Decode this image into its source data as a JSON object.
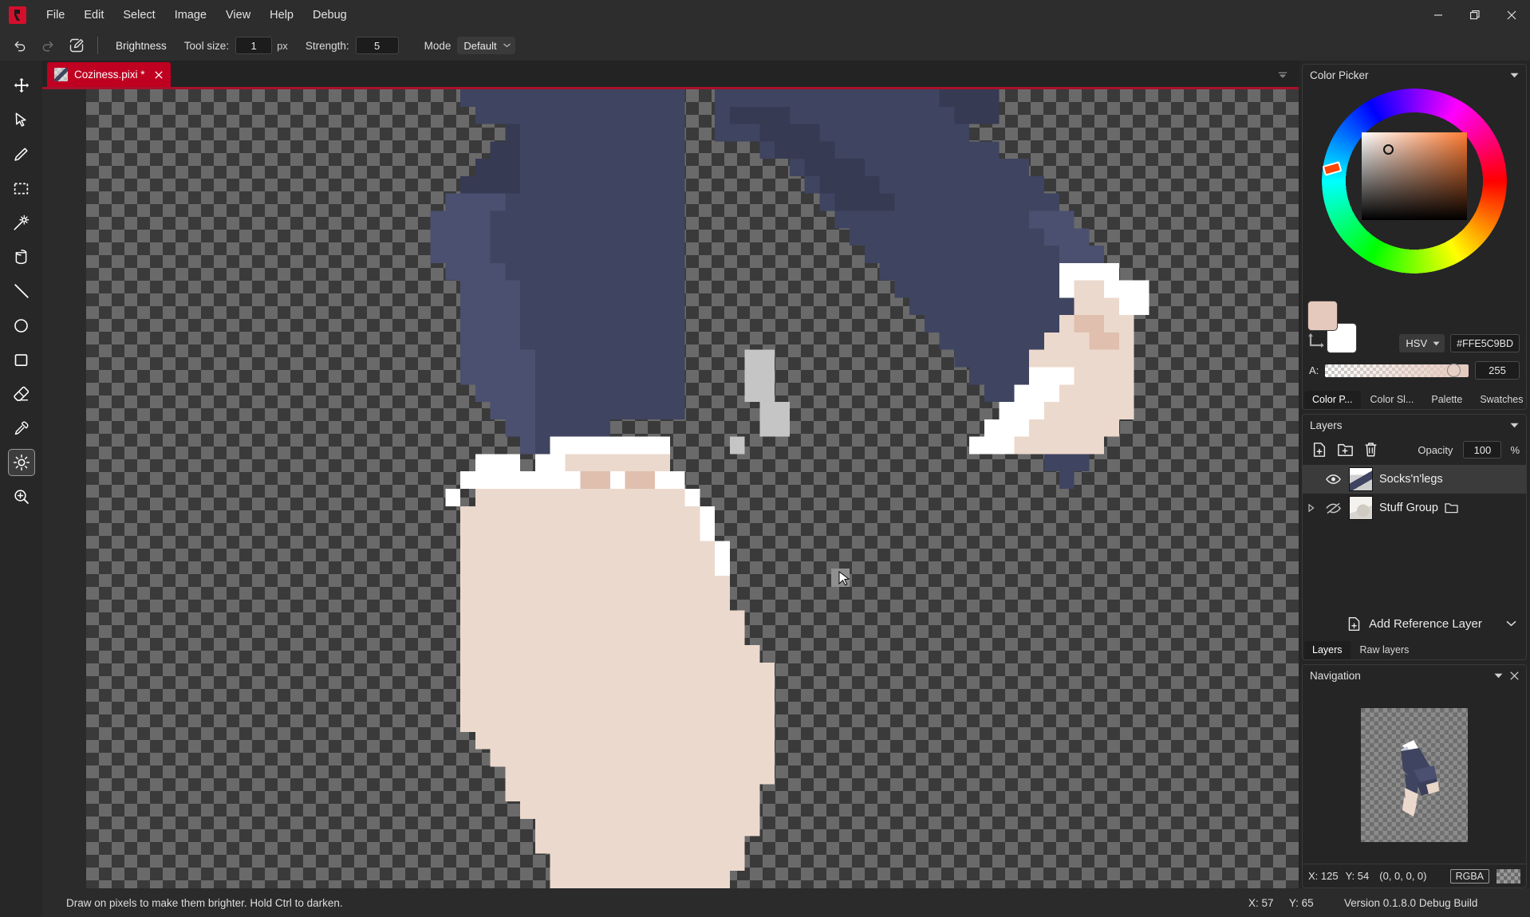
{
  "app": {
    "logo_icon": "pixi-logo-icon",
    "menu": [
      "File",
      "Edit",
      "Select",
      "Image",
      "View",
      "Help",
      "Debug"
    ],
    "window_controls": [
      {
        "name": "minimize-button",
        "icon": "minimize-icon"
      },
      {
        "name": "maximize-button",
        "icon": "maximize-icon"
      },
      {
        "name": "close-button",
        "icon": "close-icon"
      }
    ]
  },
  "optionbar": {
    "undo_icon": "undo-icon",
    "redo_icon": "redo-icon",
    "edit_icon": "edit-pencil-square-icon",
    "tool_name": "Brightness",
    "tool_size_label": "Tool size:",
    "tool_size_value": "1",
    "tool_size_unit": "px",
    "strength_label": "Strength:",
    "strength_value": "5",
    "mode_label": "Mode",
    "mode_value": "Default"
  },
  "toolbar": {
    "tools": [
      {
        "name": "tool-move",
        "icon": "move-arrows-icon",
        "label": "Move",
        "active": false
      },
      {
        "name": "tool-select-cursor",
        "icon": "cursor-arrow-icon",
        "label": "Select",
        "active": false
      },
      {
        "name": "tool-pencil",
        "icon": "pencil-icon",
        "label": "Pencil",
        "active": false
      },
      {
        "name": "tool-rect-select",
        "icon": "marquee-dashed-rect-icon",
        "label": "Rectangle Select",
        "active": false
      },
      {
        "name": "tool-magic-wand",
        "icon": "magic-wand-icon",
        "label": "Magic Wand",
        "active": false
      },
      {
        "name": "tool-bucket",
        "icon": "paint-bucket-icon",
        "label": "Bucket Fill",
        "active": false
      },
      {
        "name": "tool-line",
        "icon": "line-icon",
        "label": "Line",
        "active": false
      },
      {
        "name": "tool-ellipse",
        "icon": "ellipse-icon",
        "label": "Ellipse",
        "active": false
      },
      {
        "name": "tool-rectangle",
        "icon": "rectangle-icon",
        "label": "Rectangle",
        "active": false
      },
      {
        "name": "tool-eraser",
        "icon": "eraser-icon",
        "label": "Eraser",
        "active": false
      },
      {
        "name": "tool-eyedropper",
        "icon": "eyedropper-icon",
        "label": "Color Picker",
        "active": false
      },
      {
        "name": "tool-brightness",
        "icon": "sun-brightness-icon",
        "label": "Brightness",
        "active": true
      },
      {
        "name": "tool-zoom",
        "icon": "magnifier-plus-icon",
        "label": "Zoom",
        "active": false
      }
    ]
  },
  "tab": {
    "title": "Coziness.pixi *",
    "close_icon": "close-icon",
    "thumb_icon": "document-thumbnail-icon",
    "list_icon": "tab-list-chevron-icon",
    "accent_color": "#c00021"
  },
  "color_picker": {
    "title": "Color Picker",
    "collapse_icon": "chevron-down-icon",
    "foreground_color": "#E5C9BD",
    "background_color": "#FFFFFF",
    "swap_icon": "swap-colors-icon",
    "mode": "HSV",
    "mode_chevron_icon": "chevron-down-icon",
    "hex": "#FFE5C9BD",
    "alpha_label": "A:",
    "alpha_value": "255",
    "tabs": [
      {
        "label": "Color P...",
        "active": true
      },
      {
        "label": "Color Sl...",
        "active": false
      },
      {
        "label": "Palette",
        "active": false
      },
      {
        "label": "Swatches",
        "active": false
      }
    ]
  },
  "layers_panel": {
    "title": "Layers",
    "collapse_icon": "chevron-down-icon",
    "actions": [
      {
        "name": "add-layer-button",
        "icon": "new-file-plus-icon"
      },
      {
        "name": "add-group-button",
        "icon": "new-folder-plus-icon"
      },
      {
        "name": "delete-layer-button",
        "icon": "trash-icon"
      }
    ],
    "opacity_label": "Opacity",
    "opacity_value": "100",
    "opacity_unit": "%",
    "layers": [
      {
        "name": "Socks'n'legs",
        "visible": true,
        "selected": true,
        "is_group": false,
        "eye_icon": "eye-visible-icon"
      },
      {
        "name": "Stuff Group",
        "visible": false,
        "selected": false,
        "is_group": true,
        "eye_icon": "eye-hidden-icon",
        "twisty_icon": "triangle-right-icon",
        "folder_icon": "folder-icon"
      }
    ],
    "add_reference_label": "Add Reference Layer",
    "add_reference_icon": "new-file-plus-icon",
    "add_reference_chevron_icon": "chevron-down-icon",
    "bottom_tabs": [
      {
        "label": "Layers",
        "active": true
      },
      {
        "label": "Raw layers",
        "active": false
      }
    ]
  },
  "navigation": {
    "title": "Navigation",
    "collapse_icon": "chevron-down-icon",
    "close_icon": "close-icon",
    "cursor_x_label": "X: 125",
    "cursor_y_label": "Y: 54",
    "pixel_value": "(0, 0, 0, 0)",
    "color_mode": "RGBA"
  },
  "statusbar": {
    "hint": "Draw on pixels to make them brighter. Hold Ctrl to darken.",
    "x_label": "X: 57",
    "y_label": "Y: 65",
    "version": "Version 0.1.8.0 Debug Build"
  },
  "canvas": {
    "palette": {
      "denim_dark": "#3f4460",
      "denim_mid": "#4b5070",
      "denim_light": "#545a7c",
      "denim_deep": "#383c57",
      "skin": "#ecd9cd",
      "skin_shadow": "#e0bfaf",
      "white": "#ffffff",
      "grey": "#c5c5c5"
    },
    "cursor_overlay": "brush-cursor-square"
  }
}
